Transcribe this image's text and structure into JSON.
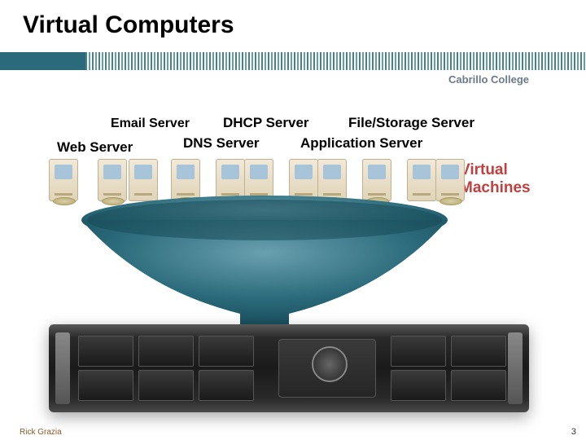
{
  "title": "Virtual Computers",
  "college": "Cabrillo College",
  "servers": {
    "email": "Email Server",
    "dhcp": "DHCP Server",
    "file": "File/Storage Server",
    "dns": "DNS Server",
    "app": "Application Server",
    "web": "Web Server"
  },
  "vm_label_line1": "Virtual",
  "vm_label_line2": "Machines",
  "footer": {
    "author": "Rick Grazia",
    "page": "3"
  }
}
